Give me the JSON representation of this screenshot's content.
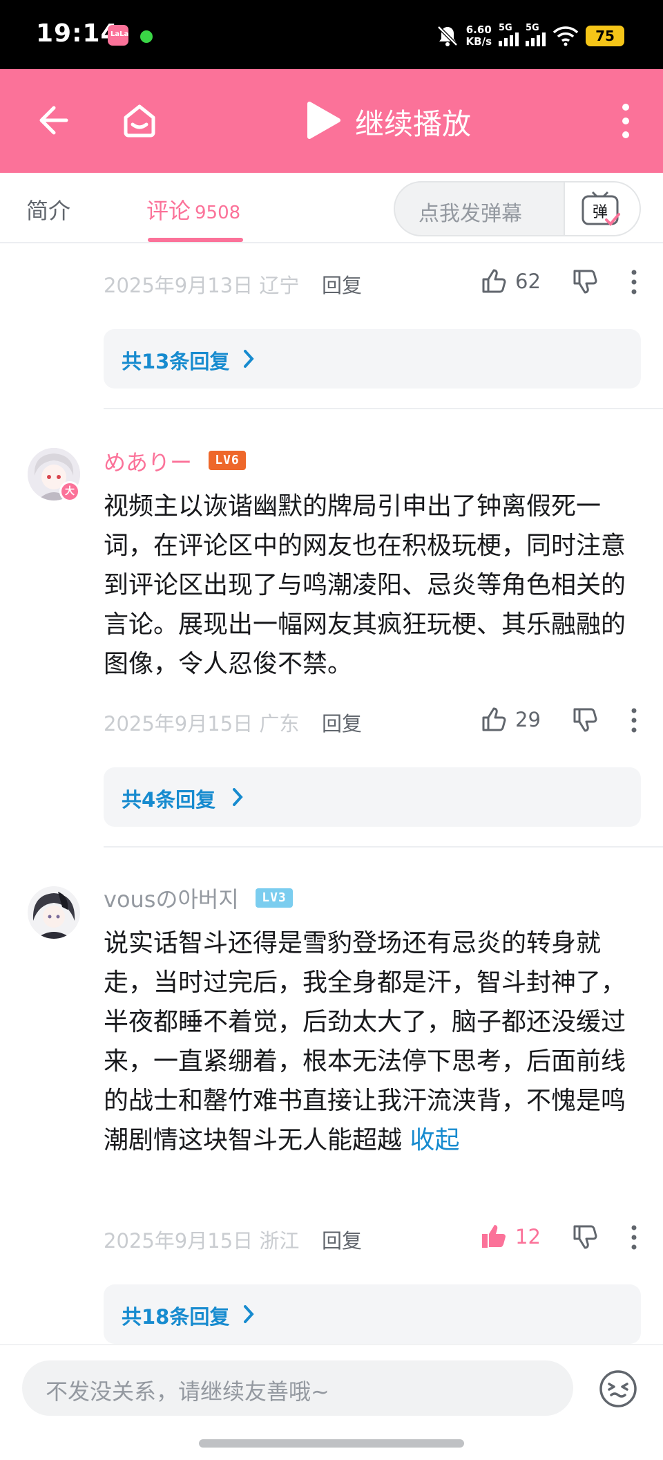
{
  "status_bar": {
    "time": "19:14",
    "app_badge": "LaLa",
    "speed_value": "6.60",
    "speed_unit": "KB/s",
    "signal1": "5G",
    "signal2": "5G",
    "battery": "75"
  },
  "header": {
    "title": "继续播放",
    "icons": [
      "back-arrow-icon",
      "home-icon",
      "play-icon",
      "more-vertical-icon"
    ]
  },
  "tabs": {
    "intro": "简介",
    "comments": "评论",
    "comment_count": "9508",
    "danmaku_placeholder": "点我发弹幕",
    "danmaku_button": "弹"
  },
  "comments": [
    {
      "date": "2025年9月13日 辽宁",
      "reply_label": "回复",
      "likes": "62",
      "liked": false,
      "replies_summary": "共13条回复"
    },
    {
      "username": "めありー",
      "level": "LV6",
      "avatar_badge": "大",
      "content": "视频主以诙谐幽默的牌局引申出了钟离假死一词，在评论区中的网友也在积极玩梗，同时注意到评论区出现了与鸣潮凌阳、忌炎等角色相关的言论。展现出一幅网友其疯狂玩梗、其乐融融的图像，令人忍俊不禁。",
      "date": "2025年9月15日 广东",
      "reply_label": "回复",
      "likes": "29",
      "liked": false,
      "replies_summary": "共4条回复"
    },
    {
      "username": "vousの아버지",
      "level": "LV3",
      "content": "说实话智斗还得是雪豹登场还有忌炎的转身就走，当时过完后，我全身都是汗，智斗封神了，半夜都睡不着觉，后劲太大了，脑子都还没缓过来，一直紧绷着，根本无法停下思考，后面前线的战士和罄竹难书直接让我汗流浃背，不愧是鸣潮剧情这块智斗无人能超越",
      "collapse_label": "收起",
      "date": "2025年9月15日 浙江",
      "reply_label": "回复",
      "likes": "12",
      "liked": true,
      "replies_summary": "共18条回复"
    }
  ],
  "bottom_bar": {
    "input_placeholder": "不发没关系，请继续友善哦~"
  },
  "colors": {
    "brand_pink": "#fb7299",
    "link_blue": "#178bcf",
    "lv6_orange": "#ee672a",
    "lv3_blue": "#7bcdef"
  }
}
